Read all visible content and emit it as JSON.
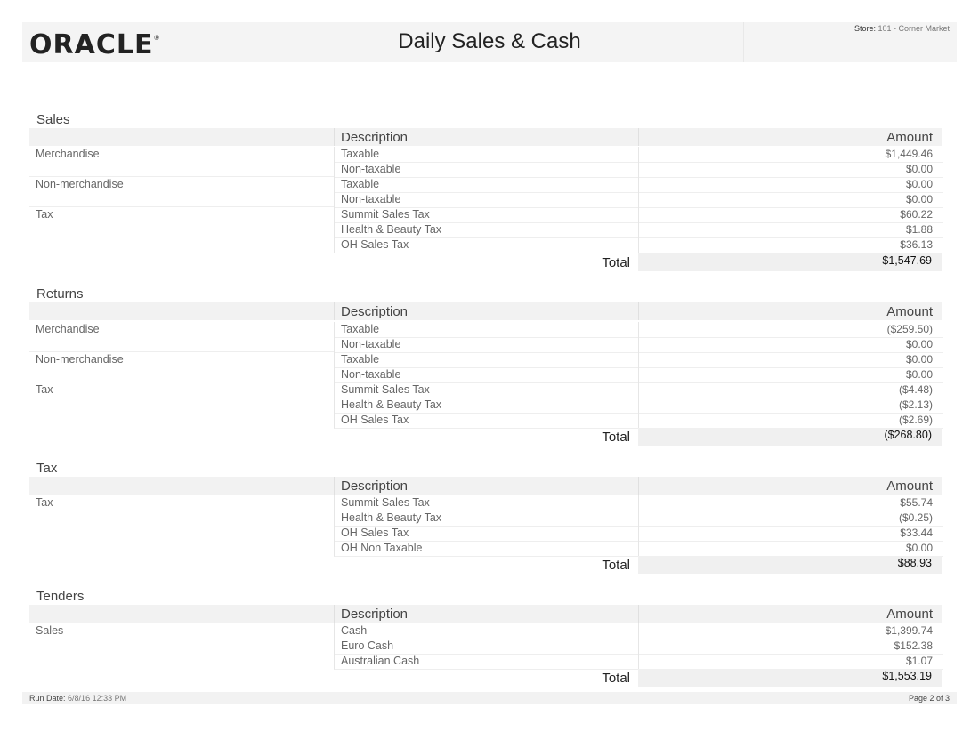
{
  "header": {
    "logo": "ORACLE",
    "logo_mark": "®",
    "title": "Daily Sales & Cash",
    "store_label": "Store:",
    "store_value": "101 - Corner Market"
  },
  "columns": {
    "description": "Description",
    "amount": "Amount"
  },
  "total_label": "Total",
  "sections": {
    "sales": {
      "title": "Sales",
      "rows": [
        {
          "category": "Merchandise",
          "description": "Taxable",
          "amount": "$1,449.46"
        },
        {
          "category": "",
          "description": "Non-taxable",
          "amount": "$0.00"
        },
        {
          "category": "Non-merchandise",
          "description": "Taxable",
          "amount": "$0.00"
        },
        {
          "category": "",
          "description": "Non-taxable",
          "amount": "$0.00"
        },
        {
          "category": "Tax",
          "description": "Summit Sales Tax",
          "amount": "$60.22"
        },
        {
          "category": "",
          "description": "Health & Beauty Tax",
          "amount": "$1.88"
        },
        {
          "category": "",
          "description": "OH Sales Tax",
          "amount": "$36.13"
        }
      ],
      "total": "$1,547.69"
    },
    "returns": {
      "title": "Returns",
      "rows": [
        {
          "category": "Merchandise",
          "description": "Taxable",
          "amount": "($259.50)"
        },
        {
          "category": "",
          "description": "Non-taxable",
          "amount": "$0.00"
        },
        {
          "category": "Non-merchandise",
          "description": "Taxable",
          "amount": "$0.00"
        },
        {
          "category": "",
          "description": "Non-taxable",
          "amount": "$0.00"
        },
        {
          "category": "Tax",
          "description": "Summit Sales Tax",
          "amount": "($4.48)"
        },
        {
          "category": "",
          "description": "Health & Beauty Tax",
          "amount": "($2.13)"
        },
        {
          "category": "",
          "description": "OH Sales Tax",
          "amount": "($2.69)"
        }
      ],
      "total": "($268.80)"
    },
    "tax": {
      "title": "Tax",
      "rows": [
        {
          "category": "Tax",
          "description": "Summit Sales Tax",
          "amount": "$55.74"
        },
        {
          "category": "",
          "description": "Health & Beauty Tax",
          "amount": "($0.25)"
        },
        {
          "category": "",
          "description": "OH Sales Tax",
          "amount": "$33.44"
        },
        {
          "category": "",
          "description": "OH Non Taxable",
          "amount": "$0.00"
        }
      ],
      "total": "$88.93"
    },
    "tenders": {
      "title": "Tenders",
      "rows": [
        {
          "category": "Sales",
          "description": "Cash",
          "amount": "$1,399.74"
        },
        {
          "category": "",
          "description": "Euro Cash",
          "amount": "$152.38"
        },
        {
          "category": "",
          "description": "Australian Cash",
          "amount": "$1.07"
        }
      ],
      "total": "$1,553.19"
    }
  },
  "footer": {
    "run_date_label": "Run Date:",
    "run_date_value": "6/8/16 12:33 PM",
    "page": "Page 2 of 3"
  }
}
